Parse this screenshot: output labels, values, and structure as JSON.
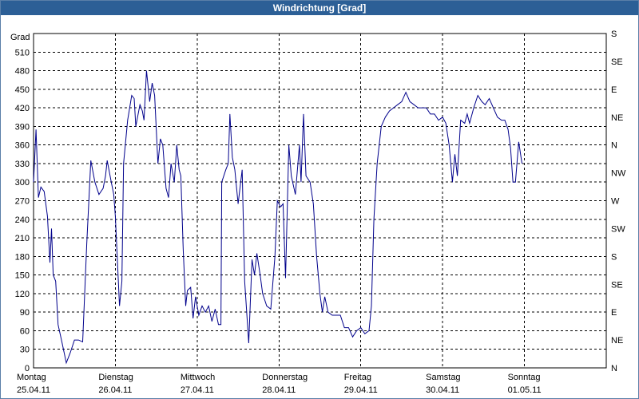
{
  "window": {
    "title": "Windrichtung [Grad]"
  },
  "colors": {
    "titlebar": "#2c5f96",
    "series": "#00008b",
    "grid": "#000000"
  },
  "chart_data": {
    "type": "line",
    "title": "Windrichtung [Grad]",
    "ylabel": "Grad",
    "ylim": [
      0,
      540
    ],
    "yticks": [
      0,
      30,
      60,
      90,
      120,
      150,
      180,
      210,
      240,
      270,
      300,
      330,
      360,
      390,
      420,
      450,
      480,
      510
    ],
    "right_ticks": [
      "N",
      "NE",
      "E",
      "SE",
      "S",
      "SW",
      "W",
      "NW",
      "N",
      "NE",
      "E",
      "SE",
      "S"
    ],
    "xlim": [
      0,
      7
    ],
    "x_ticks": [
      {
        "day": "Montag",
        "date": "25.04.11"
      },
      {
        "day": "Dienstag",
        "date": "26.04.11"
      },
      {
        "day": "Mittwoch",
        "date": "27.04.11"
      },
      {
        "day": "Donnerstag",
        "date": "28.04.11"
      },
      {
        "day": "Freitag",
        "date": "29.04.11"
      },
      {
        "day": "Samstag",
        "date": "30.04.11"
      },
      {
        "day": "Sonntag",
        "date": "01.05.11"
      }
    ],
    "grid": true,
    "series": [
      {
        "points": [
          [
            0.0,
            300
          ],
          [
            0.03,
            385
          ],
          [
            0.06,
            275
          ],
          [
            0.09,
            292
          ],
          [
            0.13,
            285
          ],
          [
            0.17,
            245
          ],
          [
            0.2,
            170
          ],
          [
            0.22,
            225
          ],
          [
            0.24,
            150
          ],
          [
            0.27,
            140
          ],
          [
            0.3,
            70
          ],
          [
            0.35,
            40
          ],
          [
            0.4,
            8
          ],
          [
            0.45,
            25
          ],
          [
            0.5,
            45
          ],
          [
            0.55,
            45
          ],
          [
            0.6,
            42
          ],
          [
            0.65,
            200
          ],
          [
            0.7,
            335
          ],
          [
            0.75,
            300
          ],
          [
            0.8,
            280
          ],
          [
            0.85,
            290
          ],
          [
            0.88,
            310
          ],
          [
            0.9,
            335
          ],
          [
            0.95,
            300
          ],
          [
            0.98,
            280
          ],
          [
            1.0,
            245
          ],
          [
            1.05,
            100
          ],
          [
            1.08,
            140
          ],
          [
            1.1,
            330
          ],
          [
            1.15,
            400
          ],
          [
            1.2,
            440
          ],
          [
            1.23,
            435
          ],
          [
            1.25,
            390
          ],
          [
            1.3,
            425
          ],
          [
            1.33,
            415
          ],
          [
            1.35,
            400
          ],
          [
            1.38,
            480
          ],
          [
            1.42,
            430
          ],
          [
            1.45,
            460
          ],
          [
            1.48,
            440
          ],
          [
            1.52,
            330
          ],
          [
            1.55,
            370
          ],
          [
            1.58,
            360
          ],
          [
            1.62,
            290
          ],
          [
            1.65,
            275
          ],
          [
            1.68,
            330
          ],
          [
            1.72,
            300
          ],
          [
            1.75,
            360
          ],
          [
            1.78,
            320
          ],
          [
            1.8,
            310
          ],
          [
            1.83,
            190
          ],
          [
            1.86,
            100
          ],
          [
            1.88,
            125
          ],
          [
            1.92,
            130
          ],
          [
            1.95,
            80
          ],
          [
            1.98,
            115
          ],
          [
            2.02,
            85
          ],
          [
            2.06,
            100
          ],
          [
            2.1,
            90
          ],
          [
            2.14,
            100
          ],
          [
            2.18,
            75
          ],
          [
            2.22,
            95
          ],
          [
            2.26,
            70
          ],
          [
            2.29,
            70
          ],
          [
            2.3,
            300
          ],
          [
            2.35,
            320
          ],
          [
            2.38,
            330
          ],
          [
            2.4,
            410
          ],
          [
            2.43,
            340
          ],
          [
            2.46,
            320
          ],
          [
            2.5,
            265
          ],
          [
            2.55,
            320
          ],
          [
            2.58,
            140
          ],
          [
            2.63,
            40
          ],
          [
            2.67,
            175
          ],
          [
            2.7,
            150
          ],
          [
            2.73,
            185
          ],
          [
            2.77,
            150
          ],
          [
            2.8,
            120
          ],
          [
            2.85,
            100
          ],
          [
            2.9,
            95
          ],
          [
            2.95,
            180
          ],
          [
            2.98,
            270
          ],
          [
            3.02,
            260
          ],
          [
            3.05,
            265
          ],
          [
            3.08,
            145
          ],
          [
            3.12,
            360
          ],
          [
            3.15,
            310
          ],
          [
            3.2,
            280
          ],
          [
            3.25,
            360
          ],
          [
            3.27,
            300
          ],
          [
            3.3,
            410
          ],
          [
            3.33,
            310
          ],
          [
            3.38,
            300
          ],
          [
            3.42,
            265
          ],
          [
            3.46,
            180
          ],
          [
            3.5,
            120
          ],
          [
            3.53,
            90
          ],
          [
            3.56,
            115
          ],
          [
            3.6,
            90
          ],
          [
            3.65,
            85
          ],
          [
            3.7,
            85
          ],
          [
            3.75,
            85
          ],
          [
            3.8,
            65
          ],
          [
            3.85,
            65
          ],
          [
            3.9,
            50
          ],
          [
            3.95,
            60
          ],
          [
            4.0,
            65
          ],
          [
            4.05,
            55
          ],
          [
            4.1,
            60
          ],
          [
            4.13,
            100
          ],
          [
            4.16,
            240
          ],
          [
            4.2,
            330
          ],
          [
            4.25,
            390
          ],
          [
            4.3,
            405
          ],
          [
            4.35,
            415
          ],
          [
            4.4,
            420
          ],
          [
            4.45,
            425
          ],
          [
            4.5,
            430
          ],
          [
            4.55,
            445
          ],
          [
            4.6,
            430
          ],
          [
            4.65,
            425
          ],
          [
            4.7,
            420
          ],
          [
            4.75,
            420
          ],
          [
            4.8,
            420
          ],
          [
            4.85,
            410
          ],
          [
            4.9,
            410
          ],
          [
            4.95,
            400
          ],
          [
            5.0,
            405
          ],
          [
            5.04,
            395
          ],
          [
            5.08,
            360
          ],
          [
            5.12,
            300
          ],
          [
            5.15,
            345
          ],
          [
            5.18,
            310
          ],
          [
            5.22,
            400
          ],
          [
            5.27,
            395
          ],
          [
            5.3,
            410
          ],
          [
            5.33,
            395
          ],
          [
            5.38,
            420
          ],
          [
            5.43,
            440
          ],
          [
            5.48,
            430
          ],
          [
            5.52,
            425
          ],
          [
            5.57,
            435
          ],
          [
            5.62,
            420
          ],
          [
            5.67,
            405
          ],
          [
            5.72,
            400
          ],
          [
            5.76,
            400
          ],
          [
            5.8,
            385
          ],
          [
            5.83,
            355
          ],
          [
            5.86,
            300
          ],
          [
            5.89,
            300
          ],
          [
            5.93,
            365
          ],
          [
            5.97,
            330
          ]
        ]
      }
    ]
  }
}
